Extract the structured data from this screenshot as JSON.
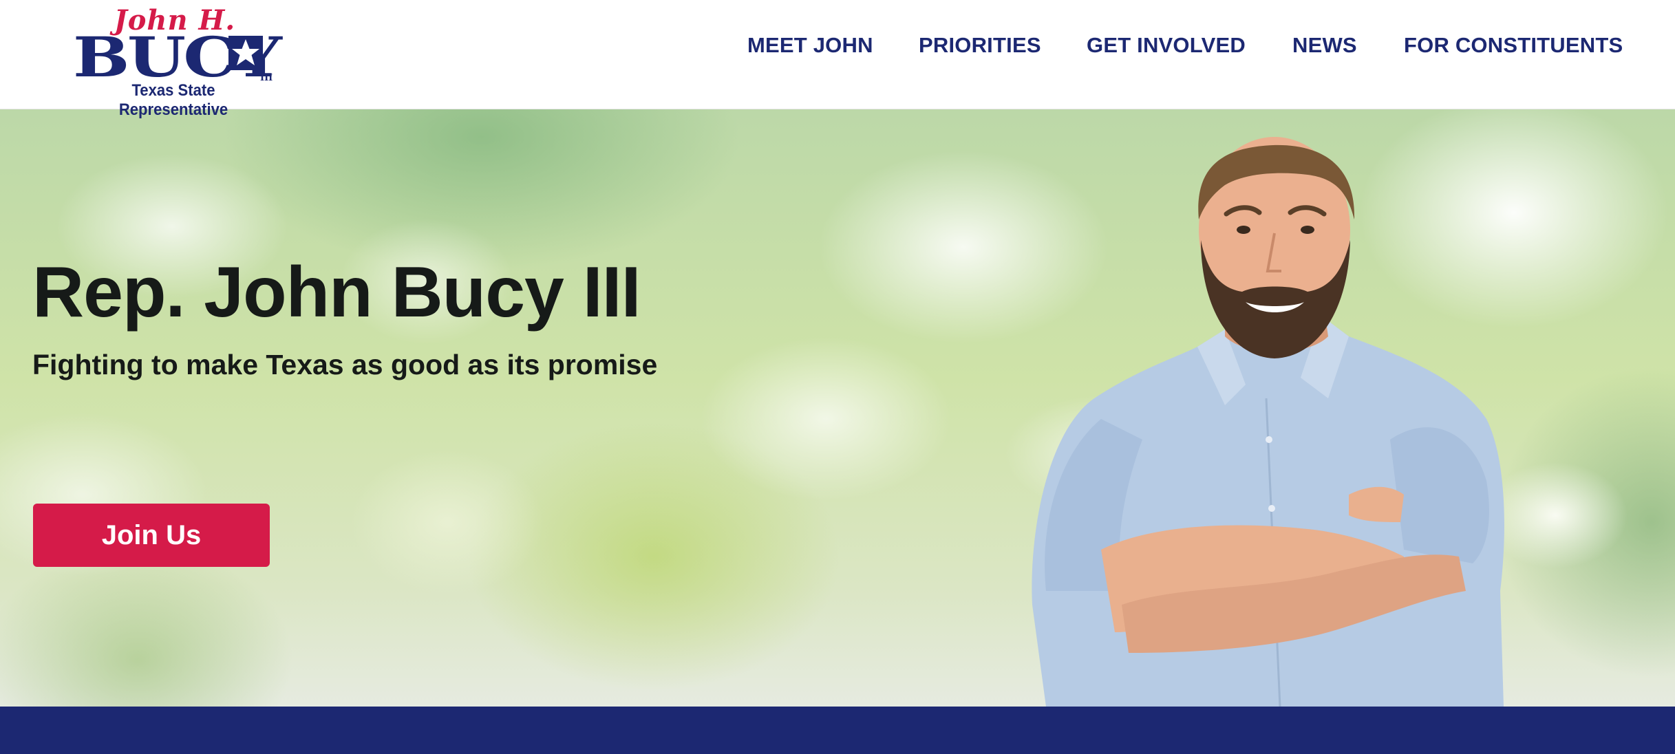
{
  "logo": {
    "name": "John H.",
    "surname": "BUCY",
    "suffix": "III",
    "title": "Texas State Representative"
  },
  "nav": {
    "items": [
      {
        "label": "MEET JOHN"
      },
      {
        "label": "PRIORITIES"
      },
      {
        "label": "GET INVOLVED"
      },
      {
        "label": "NEWS"
      },
      {
        "label": "FOR CONSTITUENTS"
      }
    ]
  },
  "hero": {
    "title": "Rep. John Bucy III",
    "subtitle": "Fighting to make Texas as good as its promise",
    "cta_label": "Join Us"
  },
  "colors": {
    "brand_navy": "#1c2872",
    "brand_red": "#d51b49",
    "text_dark": "#161a18"
  }
}
